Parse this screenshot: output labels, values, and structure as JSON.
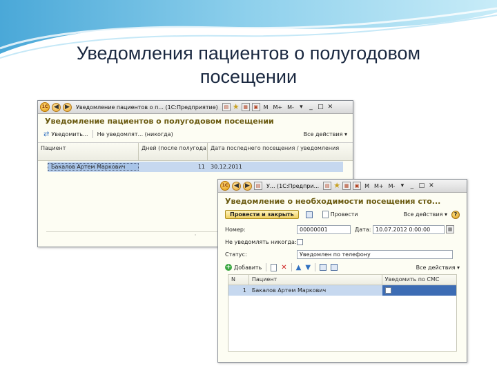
{
  "slide": {
    "title_line1": "Уведомления пациентов о полугодовом",
    "title_line2": "посещении"
  },
  "colors": {
    "accent_swoosh": "#5ab6e0",
    "form_title": "#6a5a10",
    "selected_row": "#c6d8ef"
  },
  "list_window": {
    "titlebar": {
      "caption": "Уведомление пациентов о п... (1С:Предприятие)",
      "m_label": "M",
      "mplus_label": "M+",
      "mminus_label": "M-"
    },
    "form_title": "Уведомление пациентов о полугодовом посещении",
    "commands": {
      "notify_label": "Уведомить...",
      "dont_notify_label": "Не уведомлят... (никогда)",
      "all_actions_label": "Все действия ▾"
    },
    "columns": [
      "Пациент",
      "Дней (после полугода)",
      "Дата последнего посещения / уведомления"
    ],
    "rows": [
      {
        "patient": "Бакалов Артем Маркович",
        "days": "11",
        "date": "30.12.2011"
      }
    ],
    "scrollbar_glyph": "·"
  },
  "doc_window": {
    "titlebar": {
      "caption": "У... (1С:Предпри...",
      "m_label": "M",
      "mplus_label": "M+",
      "mminus_label": "M-"
    },
    "form_title": "Уведомление о необходимости посещения сто...",
    "buttons": {
      "post_close_label": "Провести и закрыть",
      "post_label": "Провести",
      "all_actions_label": "Все действия ▾",
      "help_label": "?"
    },
    "fields": {
      "number_label": "Номер:",
      "number_value": "00000001",
      "date_label": "Дата:",
      "date_value": "10.07.2012  0:00:00",
      "never_notify_label": "Не уведомлять никогда:",
      "status_label": "Статус:",
      "status_value": "Уведомлен по телефону"
    },
    "table_commands": {
      "add_label": "Добавить",
      "all_actions_label": "Все действия ▾"
    },
    "columns": [
      "N",
      "Пациент",
      "Уведомить по СМС"
    ],
    "rows": [
      {
        "n": "1",
        "patient": "Бакалов Артем Маркович"
      }
    ]
  }
}
